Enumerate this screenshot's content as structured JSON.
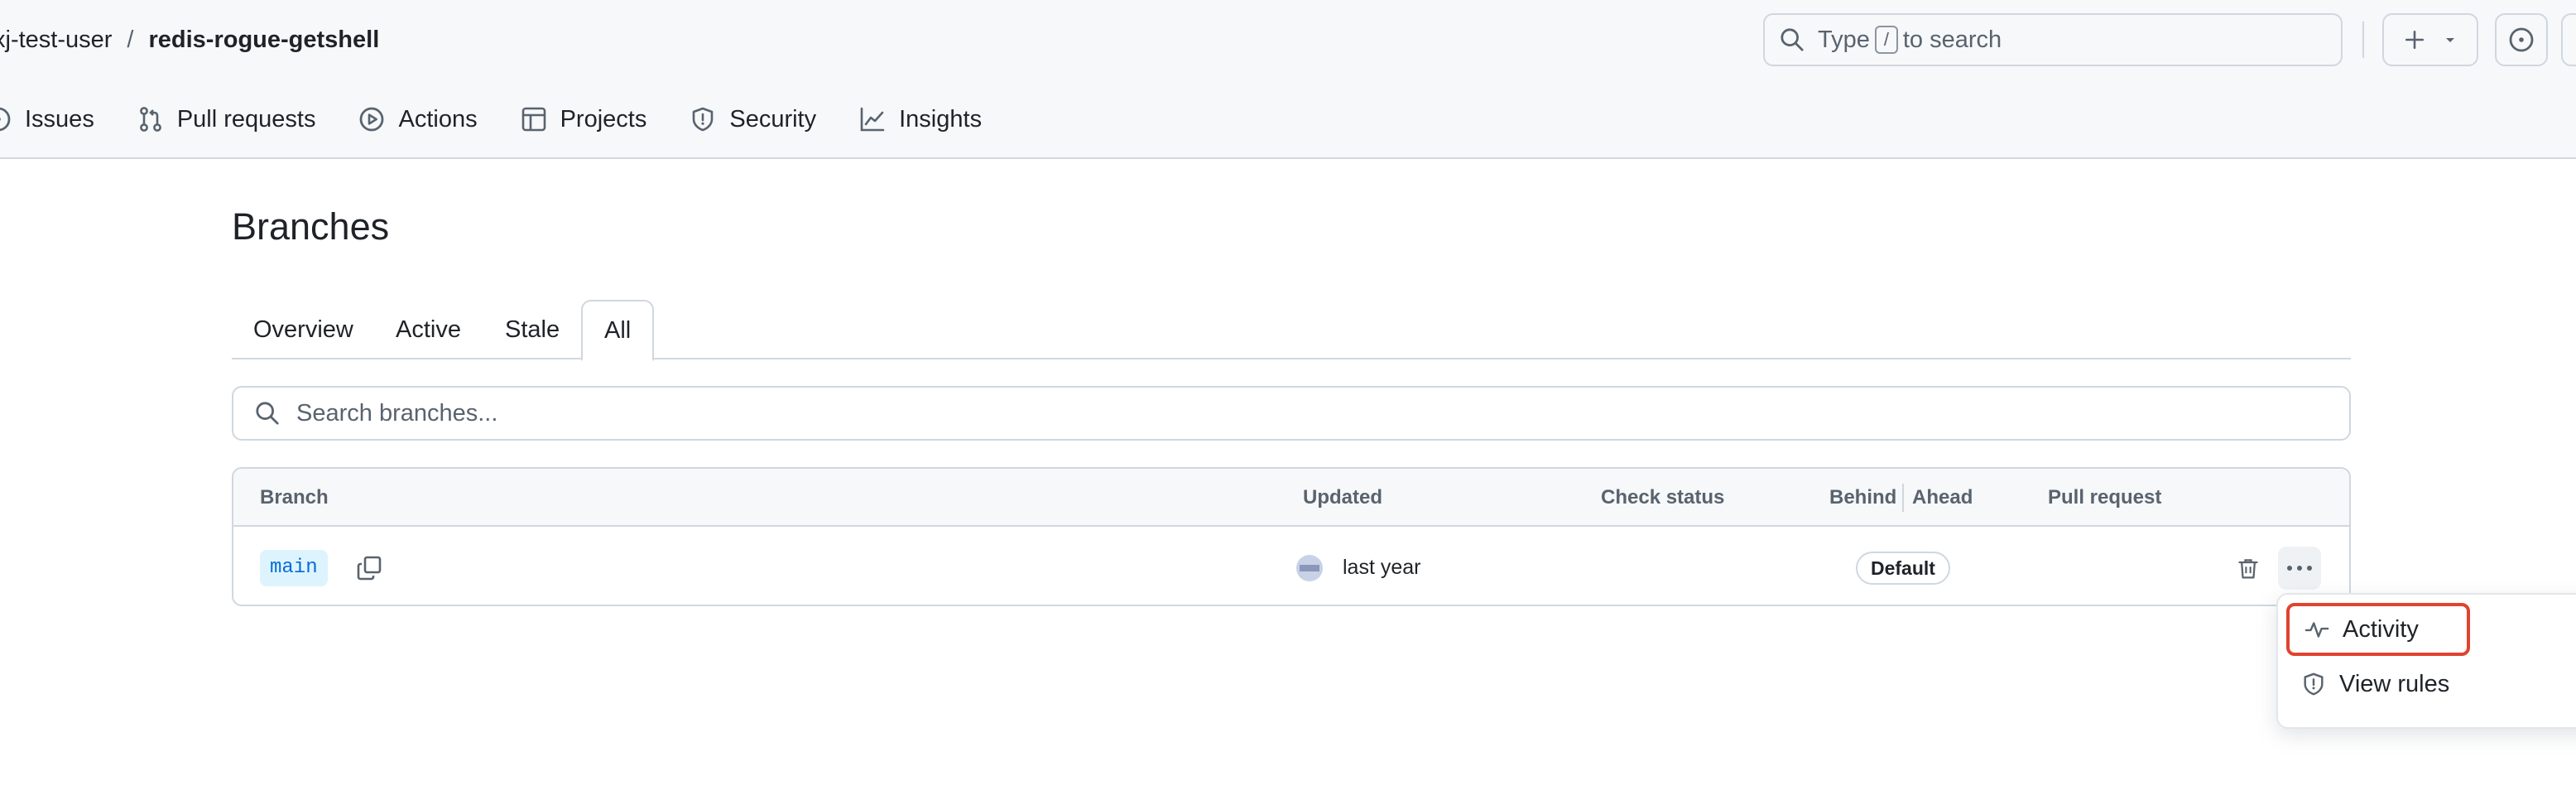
{
  "header": {
    "owner": "xj-test-user",
    "separator": "/",
    "repo": "redis-rogue-getshell",
    "search": {
      "prefix": "Type",
      "shortcut": "/",
      "suffix": "to search"
    },
    "icons": {
      "search": "search-icon",
      "create": "plus-icon",
      "caret": "triangle-down-icon",
      "issues": "issue-opened-icon"
    }
  },
  "nav": {
    "items": [
      {
        "label": "Issues",
        "icon": "issue-opened-icon"
      },
      {
        "label": "Pull requests",
        "icon": "git-pull-request-icon"
      },
      {
        "label": "Actions",
        "icon": "play-icon"
      },
      {
        "label": "Projects",
        "icon": "table-icon"
      },
      {
        "label": "Security",
        "icon": "shield-icon"
      },
      {
        "label": "Insights",
        "icon": "graph-icon"
      }
    ]
  },
  "main": {
    "title": "Branches",
    "tabs": [
      {
        "label": "Overview"
      },
      {
        "label": "Active"
      },
      {
        "label": "Stale"
      },
      {
        "label": "All",
        "selected": true
      }
    ],
    "search_placeholder": "Search branches..."
  },
  "table": {
    "columns": {
      "branch": "Branch",
      "updated": "Updated",
      "check_status": "Check status",
      "behind": "Behind",
      "ahead": "Ahead",
      "pull_request": "Pull request"
    },
    "rows": [
      {
        "branch": "main",
        "updated": "last year",
        "badge": "Default"
      }
    ]
  },
  "menu": {
    "items": [
      {
        "label": "Activity",
        "icon": "pulse-icon",
        "highlighted": true
      },
      {
        "label": "View rules",
        "icon": "shield-icon"
      }
    ]
  },
  "colors": {
    "accent": "#0969da",
    "branch_chip_bg": "#ddf4ff",
    "highlight_border": "#e0432f",
    "border": "#d0d7de"
  }
}
